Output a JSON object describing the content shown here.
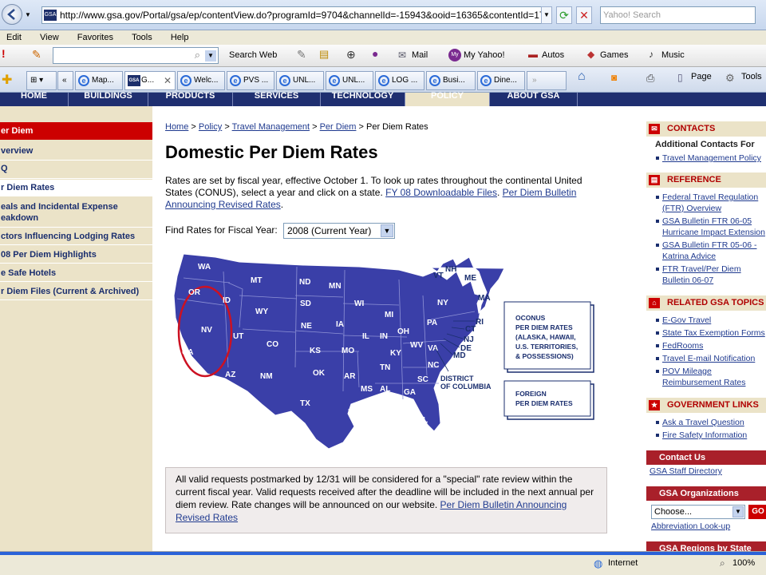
{
  "browser": {
    "url": "http://www.gsa.gov/Portal/gsa/ep/contentView.do?programId=9704&channelId=-15943&ooid=16365&contentId=17943&p",
    "search_placeholder": "Yahoo! Search",
    "menu": [
      "Edit",
      "View",
      "Favorites",
      "Tools",
      "Help"
    ],
    "yahoo_toolbar": {
      "search_web": "Search Web",
      "items": [
        "Mail",
        "My Yahoo!",
        "Autos",
        "Games",
        "Music"
      ]
    },
    "tabs": [
      "Map...",
      "G...",
      "Welc...",
      "PVS ...",
      "UNL...",
      "UNL...",
      "LOG ...",
      "Busi...",
      "Dine..."
    ],
    "command_bar": {
      "page": "Page",
      "tools": "Tools"
    },
    "status": {
      "zone": "Internet",
      "zoom": "100%"
    }
  },
  "site_nav": [
    "HOME",
    "BUILDINGS",
    "PRODUCTS",
    "SERVICES",
    "TECHNOLOGY",
    "POLICY",
    "ABOUT GSA"
  ],
  "left_nav": {
    "header": "er Diem",
    "items": [
      "verview",
      "Q",
      "r Diem Rates",
      "eals and Incidental Expense eakdown",
      "ctors Influencing Lodging Rates",
      "08 Per Diem Highlights",
      "e Safe Hotels",
      "r Diem Files (Current & Archived)"
    ]
  },
  "breadcrumb": {
    "links": [
      "Home",
      "Policy",
      "Travel Management",
      "Per Diem"
    ],
    "current": "Per Diem Rates",
    "separator": ">"
  },
  "page_title": "Domestic Per Diem Rates",
  "intro": {
    "text": "Rates are set by fiscal year, effective October 1.  To look up rates throughout the continental United States (CONUS), select a year and click on a state.",
    "link1": "FY 08 Downloadable Files",
    "link2": "Per Diem Bulletin Announcing Revised Rates",
    "end": "."
  },
  "fiscal_year": {
    "label": "Find Rates for Fiscal Year:",
    "selected": "2008 (Current Year)"
  },
  "map": {
    "states": [
      "WA",
      "OR",
      "CA",
      "NV",
      "ID",
      "MT",
      "WY",
      "UT",
      "AZ",
      "CO",
      "NM",
      "ND",
      "SD",
      "NE",
      "KS",
      "OK",
      "TX",
      "MN",
      "IA",
      "MO",
      "AR",
      "LA",
      "WI",
      "IL",
      "MI",
      "IN",
      "OH",
      "KY",
      "TN",
      "MS",
      "AL",
      "GA",
      "FL",
      "SC",
      "NC",
      "VA",
      "WV",
      "PA",
      "NY",
      "VT",
      "NH",
      "ME",
      "MA",
      "RI",
      "CT",
      "NJ",
      "DE",
      "MD"
    ],
    "dc_label_1": "DISTRICT",
    "dc_label_2": "OF COLUMBIA",
    "oconus": [
      "OCONUS",
      "PER DIEM RATES",
      "(ALASKA, HAWAII,",
      "U.S. TERRITORIES,",
      "& POSSESSIONS)"
    ],
    "foreign": [
      "FOREIGN",
      "PER DIEM RATES"
    ],
    "map_color": "#3a3fa8",
    "highlight_color": "#cc1122"
  },
  "notice": {
    "text": "All valid requests postmarked by 12/31 will be considered for a \"special\" rate review within the current fiscal year.  Valid requests received after the deadline will be included in the next annual per diem review. Rate changes will be announced on our website.",
    "link": "Per Diem Bulletin Announcing Revised Rates"
  },
  "right_sidebar": {
    "contacts": {
      "title": "CONTACTS",
      "subtitle": "Additional Contacts For",
      "links": [
        "Travel Management Policy"
      ]
    },
    "reference": {
      "title": "REFERENCE",
      "links": [
        "Federal Travel Regulation (FTR) Overview",
        "GSA Bulletin FTR 06-05 Hurricane Impact Extension",
        "GSA Bulletin FTR 05-06 - Katrina Advice",
        "FTR Travel/Per Diem Bulletin 06-07"
      ]
    },
    "related": {
      "title": "RELATED GSA TOPICS",
      "links": [
        "E-Gov Travel",
        "State Tax Exemption Forms",
        "FedRooms",
        "Travel E-mail Notification",
        "POV Mileage Reimbursement Rates"
      ]
    },
    "government": {
      "title": "GOVERNMENT LINKS",
      "links": [
        "Ask a Travel Question",
        "Fire Safety Information"
      ]
    },
    "contact_us": {
      "title": "Contact Us",
      "link": "GSA Staff Directory"
    },
    "orgs": {
      "title": "GSA Organizations",
      "select": "Choose...",
      "go": "GO",
      "link": "Abbreviation Look-up"
    },
    "regions": {
      "title": "GSA Regions by State"
    }
  },
  "colors": {
    "nav_blue": "#1f2f70",
    "sidebar_tan": "#ebe3c8",
    "accent_red": "#cc0000",
    "link_blue": "#1f3a8f"
  }
}
